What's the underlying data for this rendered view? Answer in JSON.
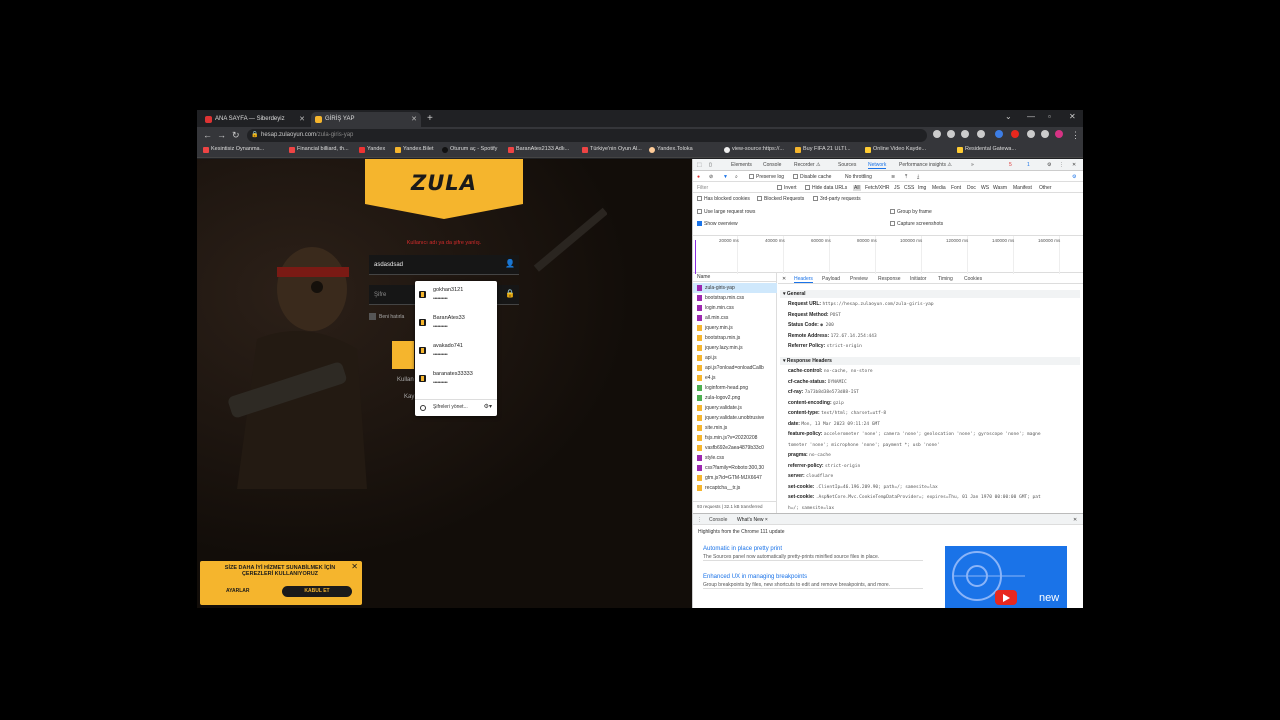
{
  "browser": {
    "tabs": [
      {
        "title": "ANA SAYFA — Siberdeyiz",
        "active": false
      },
      {
        "title": "GİRİŞ YAP",
        "active": true
      }
    ],
    "url_host": "hesap.zulaoyun.com",
    "url_path": "/zula-giris-yap",
    "bookmarks": [
      "Kesintisiz Oynanma...",
      "Financial billiard, th...",
      "Yandex",
      "Yandex.Bilet",
      "Oturum aç - Spotify",
      "BaranAtes2133 Adlı...",
      "Türkiye'nin Oyun Al...",
      "Yandex.Toloka",
      "view-source:https://...",
      "Buy FIFA 21 ULTI...",
      "Online Video Kayde...",
      "Residental Gatewa..."
    ]
  },
  "page": {
    "logo": "ZULA",
    "error": "Kullanıcı adı ya da şifre yanlış.",
    "username_value": "asdasdsad",
    "password_placeholder": "Şifre",
    "remember": "Beni hatırla",
    "link1": "Kullan",
    "link2": "Kay",
    "autocomplete": [
      {
        "user": "gokhan3121",
        "pass": "••••••••••"
      },
      {
        "user": "BaranAtes33",
        "pass": "••••••••••"
      },
      {
        "user": "avakado741",
        "pass": "••••••••••"
      },
      {
        "user": "baranates33333",
        "pass": "••••••••••"
      }
    ],
    "manage": "Şifreleri yönet...",
    "cookie_text": "SİZE DAHA İYİ HİZMET SUNABİLMEK İÇİN ÇEREZLERİ KULLANIYORUZ",
    "cookie_settings": "AYARLAR",
    "cookie_accept": "KABUL ET"
  },
  "devtools": {
    "tabs": [
      "Elements",
      "Console",
      "Recorder ⚠",
      "Sources",
      "Network",
      "Performance insights ⚠"
    ],
    "badge_errors": "5",
    "badge_msgs": "1",
    "preserve_log": "Preserve log",
    "disable_cache": "Disable cache",
    "throttle": "No throttling",
    "filter_label": "Filter",
    "invert": "Invert",
    "hide_data": "Hide data URLs",
    "types": [
      "All",
      "Fetch/XHR",
      "JS",
      "CSS",
      "Img",
      "Media",
      "Font",
      "Doc",
      "WS",
      "Wasm",
      "Manifest",
      "Other"
    ],
    "has_blocked": "Has blocked cookies",
    "blocked_req": "Blocked Requests",
    "third_party": "3rd-party requests",
    "large_rows": "Use large request rows",
    "group_frame": "Group by frame",
    "show_overview": "Show overview",
    "capture": "Capture screenshots",
    "timeline": [
      "20000 ms",
      "40000 ms",
      "60000 ms",
      "80000 ms",
      "100000 ms",
      "120000 ms",
      "140000 ms",
      "160000 ms"
    ],
    "name_header": "Name",
    "requests": [
      "zula-giris-yap",
      "bootstrap.min.css",
      "login.min.css",
      "all.min.css",
      "jquery.min.js",
      "bootstrap.min.js",
      "jquery.lazy.min.js",
      "api.js",
      "api.js?onload=onloadCallb",
      "e4.js",
      "loginform-head.png",
      "zula-logov2.png",
      "jquery.validate.js",
      "jquery.validate.unobtrusive",
      "site.min.js",
      "fsjs.min.js?v=20220208",
      "vasfb692e2aea4879b33c0",
      "style.css",
      "css?family=Roboto:300,30",
      "gtm.js?id=GTM-MJX6647",
      "recaptcha__tr.js"
    ],
    "footer": "93 requests  |  32.1 kB transferred",
    "detail_tabs": [
      "Headers",
      "Payload",
      "Preview",
      "Response",
      "Initiator",
      "Timing",
      "Cookies"
    ],
    "general_title": "General",
    "general": [
      [
        "Request URL:",
        "https://hesap.zulaoyun.com/zula-giris-yap"
      ],
      [
        "Request Method:",
        "POST"
      ],
      [
        "Status Code:",
        "● 200"
      ],
      [
        "Remote Address:",
        "172.67.14.254:443"
      ],
      [
        "Referrer Policy:",
        "strict-origin"
      ]
    ],
    "response_title": "Response Headers",
    "response": [
      [
        "cache-control:",
        "no-cache, no-store"
      ],
      [
        "cf-cache-status:",
        "DYNAMIC"
      ],
      [
        "cf-ray:",
        "7a73b8d38e573d88-IST"
      ],
      [
        "content-encoding:",
        "gzip"
      ],
      [
        "content-type:",
        "text/html; charset=utf-8"
      ],
      [
        "date:",
        "Mon, 13 Mar 2023 09:11:24 GMT"
      ],
      [
        "feature-policy:",
        "accelerometer 'none'; camera 'none'; geolocation 'none'; gyroscope 'none'; magne"
      ],
      [
        "",
        "tometer 'none'; microphone 'none'; payment *; usb 'none'"
      ],
      [
        "pragma:",
        "no-cache"
      ],
      [
        "referrer-policy:",
        "strict-origin"
      ],
      [
        "server:",
        "cloudflare"
      ],
      [
        "set-cookie:",
        ".ClientIp=46.196.209.90; path=/; samesite=lax"
      ],
      [
        "set-cookie:",
        ".AspNetCore.Mvc.CookieTempDataProvider=; expires=Thu, 01 Jan 1970 00:00:00 GMT; pat"
      ],
      [
        "",
        "h=/; samesite=lax"
      ]
    ],
    "drawer_tabs": [
      "Console",
      "What's New ×"
    ],
    "highlights": "Highlights from the Chrome 111 update",
    "cards": [
      {
        "h": "Automatic in place pretty print",
        "d": "The Sources panel now automatically pretty-prints minified source files in place."
      },
      {
        "h": "Enhanced UX in managing breakpoints",
        "d": "Group breakpoints by files, new shortcuts to edit and remove breakpoints, and more."
      }
    ],
    "promo_word": "new"
  },
  "colors": {
    "accent": "#f5b52d",
    "error": "#d42b2b",
    "link": "#1a73e8"
  }
}
